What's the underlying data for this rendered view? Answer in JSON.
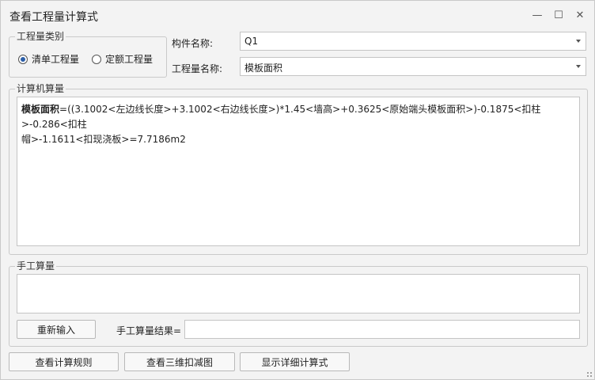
{
  "window": {
    "title": "查看工程量计算式",
    "minimize": "—",
    "maximize": "☐",
    "close": "✕"
  },
  "category": {
    "label": "工程量类别",
    "options": [
      "清单工程量",
      "定额工程量"
    ],
    "selected": "清单工程量"
  },
  "component": {
    "label": "构件名称:",
    "value": "Q1"
  },
  "quantity": {
    "label": "工程量名称:",
    "value": "模板面积"
  },
  "computer": {
    "label": "计算机算量",
    "formula_name": "模板面积",
    "formula_line1": "=((3.1002<左边线长度>+3.1002<右边线长度>)*1.45<墙高>+0.3625<原始端头模板面积>)-0.1875<扣柱>-0.286<扣柱",
    "formula_line2": "帽>-1.1611<扣现浇板>=7.7186m2"
  },
  "manual": {
    "label": "手工算量",
    "reenter_button": "重新输入",
    "result_label": "手工算量结果="
  },
  "buttons": {
    "view_rules": "查看计算规则",
    "view_3d": "查看三维扣减图",
    "show_detail": "显示详细计算式"
  }
}
